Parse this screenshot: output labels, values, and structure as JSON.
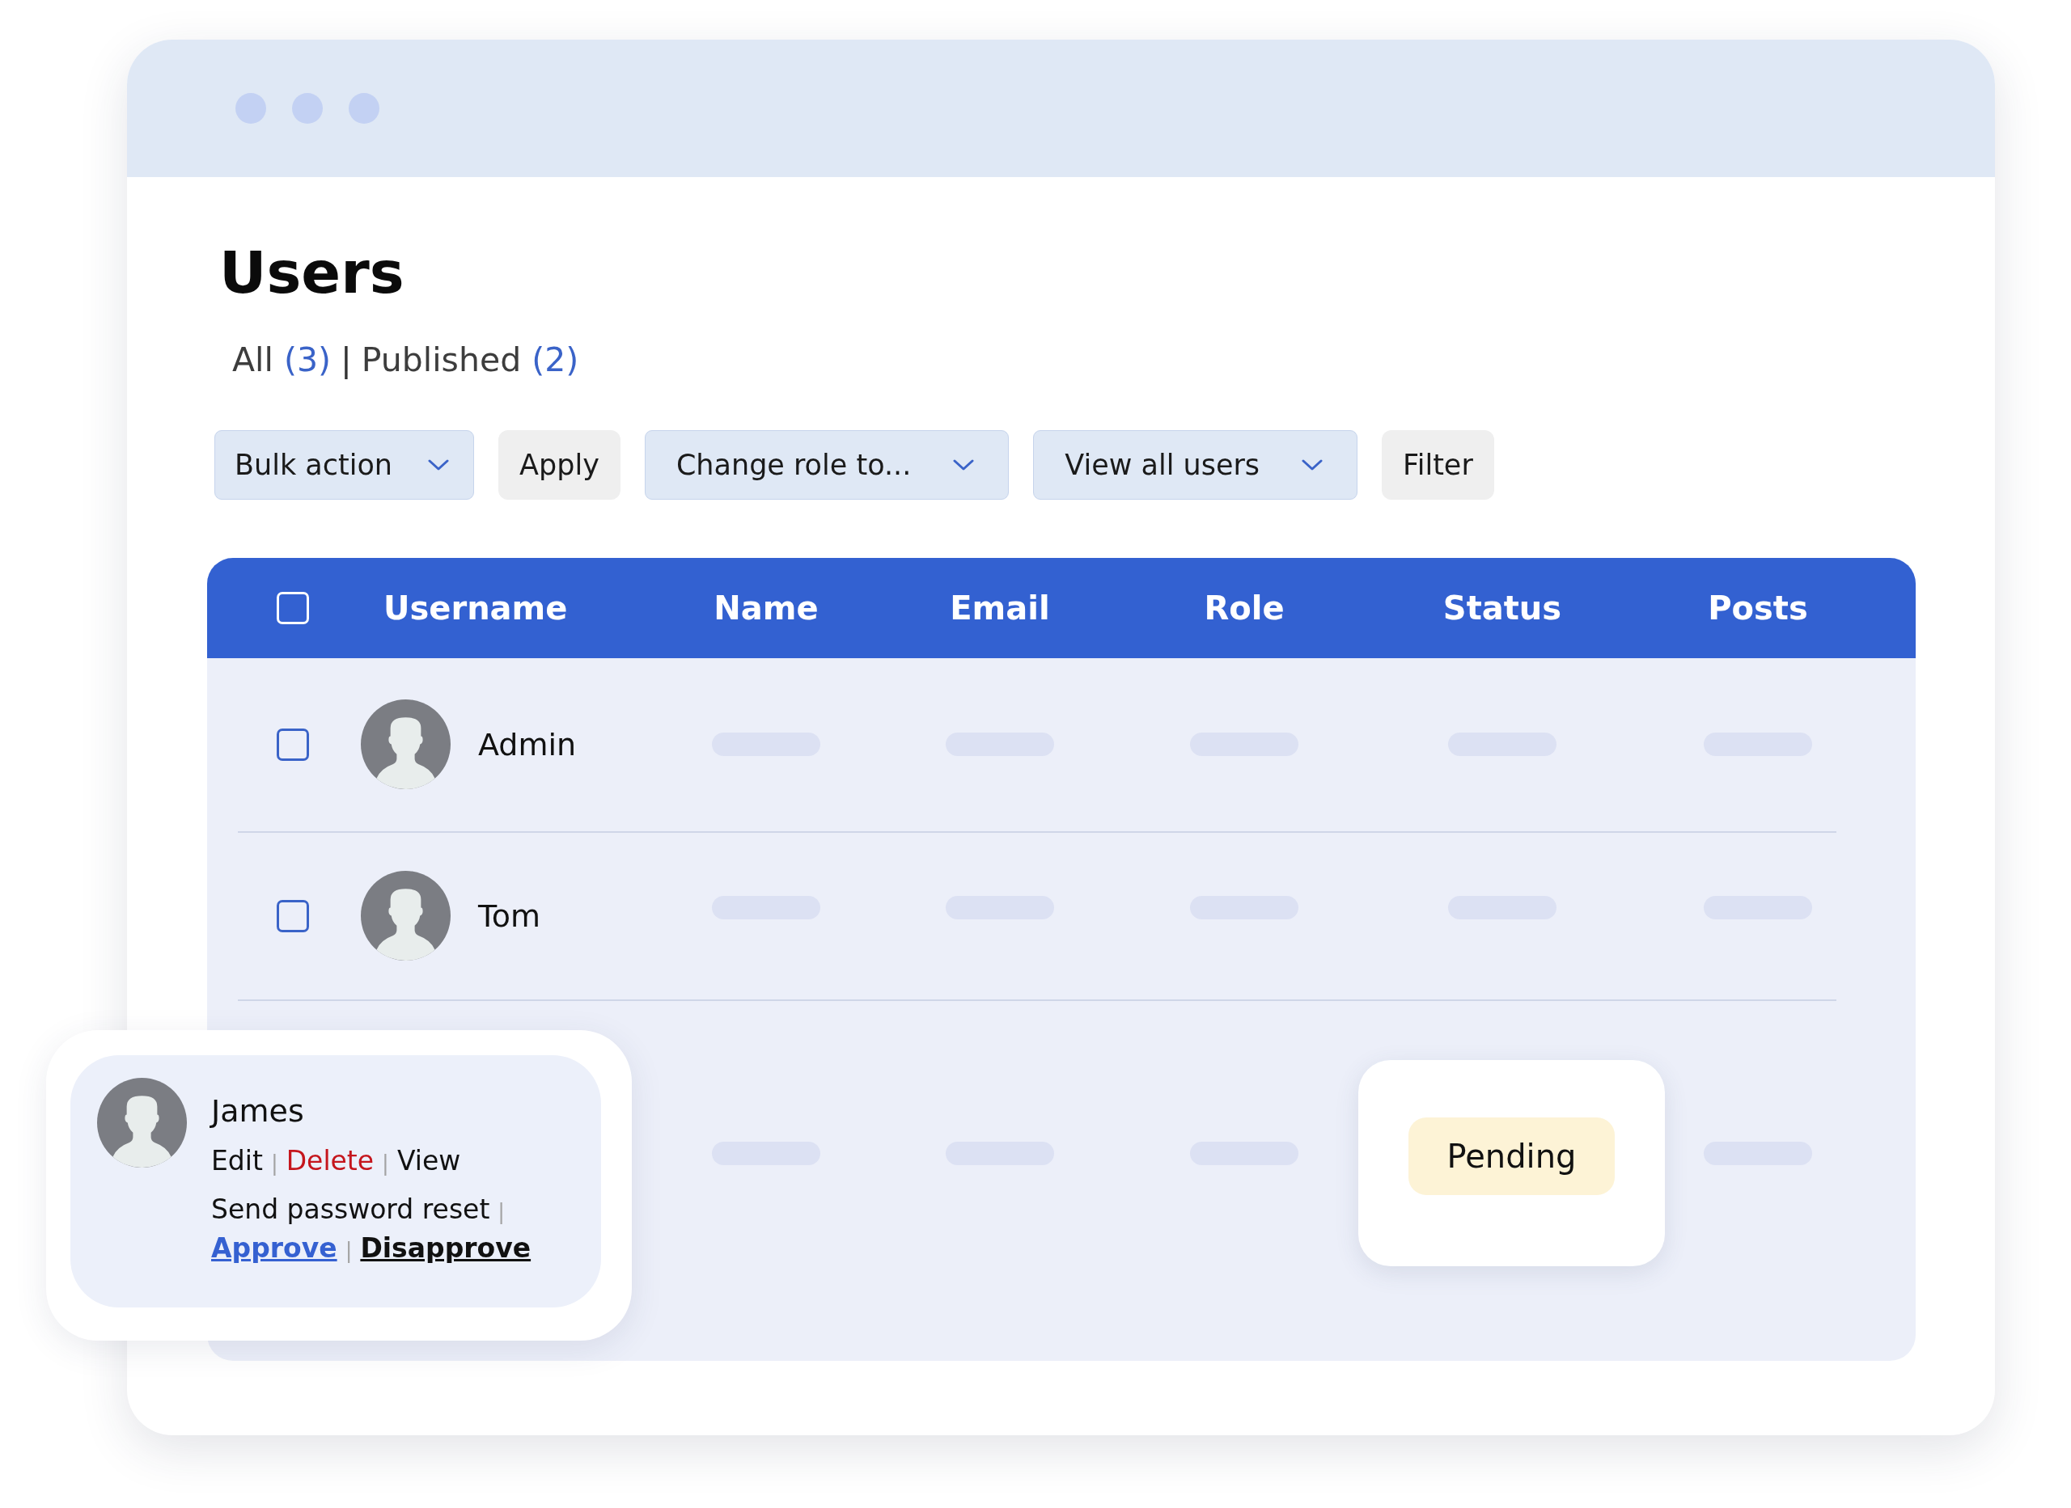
{
  "page": {
    "title": "Users"
  },
  "filters": {
    "separator": "|",
    "items": [
      {
        "label": "All",
        "count": "(3)"
      },
      {
        "label": "Published",
        "count": "(2)"
      }
    ]
  },
  "toolbar": [
    {
      "kind": "dropdown",
      "label": "Bulk action"
    },
    {
      "kind": "button",
      "label": "Apply"
    },
    {
      "kind": "dropdown",
      "label": "Change role to..."
    },
    {
      "kind": "dropdown",
      "label": "View all users"
    },
    {
      "kind": "button",
      "label": "Filter"
    }
  ],
  "table": {
    "select_all": {
      "checked": false
    },
    "columns": [
      "Username",
      "Name",
      "Email",
      "Role",
      "Status",
      "Posts"
    ],
    "rows": [
      {
        "username": "Admin",
        "checked": false
      },
      {
        "username": "Tom",
        "checked": false
      }
    ],
    "hovered_row": {
      "user_card": {
        "name": "James",
        "separator": "|",
        "action_groups": [
          [
            {
              "label": "Edit",
              "kind": "plain"
            },
            {
              "label": "Delete",
              "kind": "danger"
            },
            {
              "label": "View",
              "kind": "plain"
            }
          ],
          [
            {
              "label": "Send password reset",
              "kind": "plain"
            },
            {
              "label": "Approve",
              "kind": "primary"
            },
            {
              "label": "Disapprove",
              "kind": "strong"
            }
          ]
        ]
      },
      "status": "Pending"
    }
  }
}
